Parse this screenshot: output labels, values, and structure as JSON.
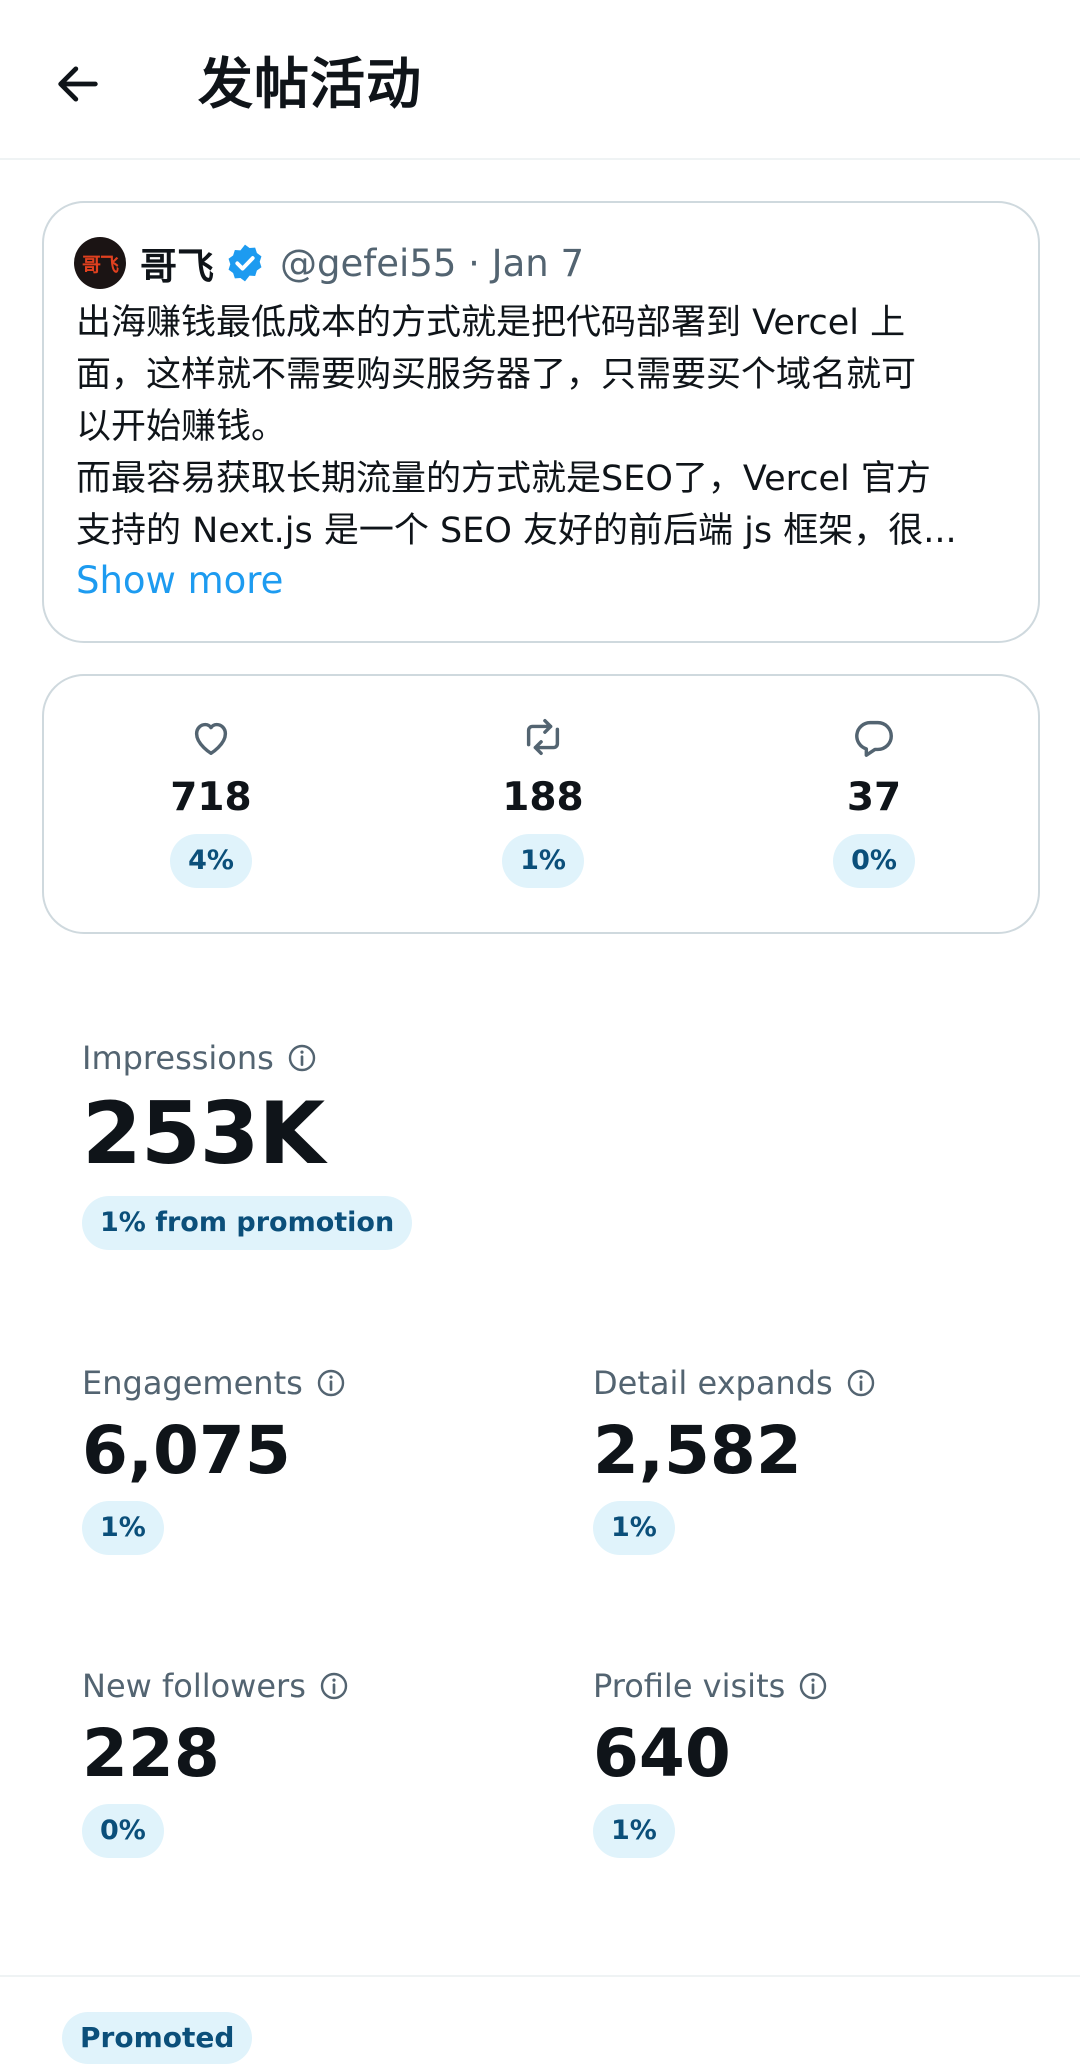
{
  "header": {
    "back_icon": "arrow-left-icon",
    "title": "发帖活动"
  },
  "tweet": {
    "avatar_text": "哥飞",
    "author_name": "哥飞",
    "verified_icon": "verified-badge-icon",
    "handle_date": "@gefei55 · Jan 7",
    "text": "出海赚钱最低成本的方式就是把代码部署到 Vercel 上\n面，这样就不需要购买服务器了，只需要买个域名就可\n以开始赚钱。\n而最容易获取长期流量的方式就是SEO了，Vercel 官方\n支持的 Next.js 是一个 SEO 友好的前后端 js 框架，很...",
    "show_more": "Show more",
    "link_color": "#1d9bf0"
  },
  "stats": {
    "likes": {
      "icon": "heart-icon",
      "value": "718",
      "pct": "4%"
    },
    "reposts": {
      "icon": "repost-icon",
      "value": "188",
      "pct": "1%"
    },
    "replies": {
      "icon": "reply-icon",
      "value": "37",
      "pct": "0%"
    }
  },
  "metrics": {
    "impressions": {
      "label": "Impressions",
      "value": "253K",
      "badge": "1% from promotion"
    },
    "engagements": {
      "label": "Engagements",
      "value": "6,075",
      "badge": "1%"
    },
    "detail_expands": {
      "label": "Detail expands",
      "value": "2,582",
      "badge": "1%"
    },
    "new_followers": {
      "label": "New followers",
      "value": "228",
      "badge": "0%"
    },
    "profile_visits": {
      "label": "Profile visits",
      "value": "640",
      "badge": "1%"
    }
  },
  "footer": {
    "promoted": "Promoted"
  },
  "colors": {
    "pill_bg": "#e0f3fb",
    "pill_text": "#0b4f7a",
    "verified": "#1d9bf0",
    "muted": "#536471"
  }
}
